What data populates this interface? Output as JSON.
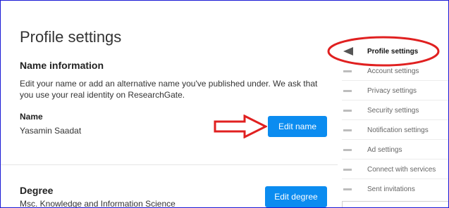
{
  "page": {
    "title": "Profile settings"
  },
  "name_info": {
    "section_title": "Name information",
    "description": "Edit your name or add an alternative name you've published under. We ask that you use your real identity on ResearchGate.",
    "name_label": "Name",
    "name_value": "Yasamin Saadat",
    "edit_button": "Edit name"
  },
  "degree": {
    "section_title": "Degree",
    "value": "Msc. Knowledge and Information Science",
    "edit_button": "Edit degree"
  },
  "sidebar": {
    "items": [
      {
        "label": "Profile settings",
        "active": true
      },
      {
        "label": "Account settings"
      },
      {
        "label": "Privacy settings"
      },
      {
        "label": "Security settings"
      },
      {
        "label": "Notification settings"
      },
      {
        "label": "Ad settings"
      },
      {
        "label": "Connect with services"
      },
      {
        "label": "Sent invitations"
      }
    ]
  },
  "colors": {
    "accent": "#0b8cf0",
    "annotation": "#e02020",
    "frame": "#1a1ad6"
  }
}
